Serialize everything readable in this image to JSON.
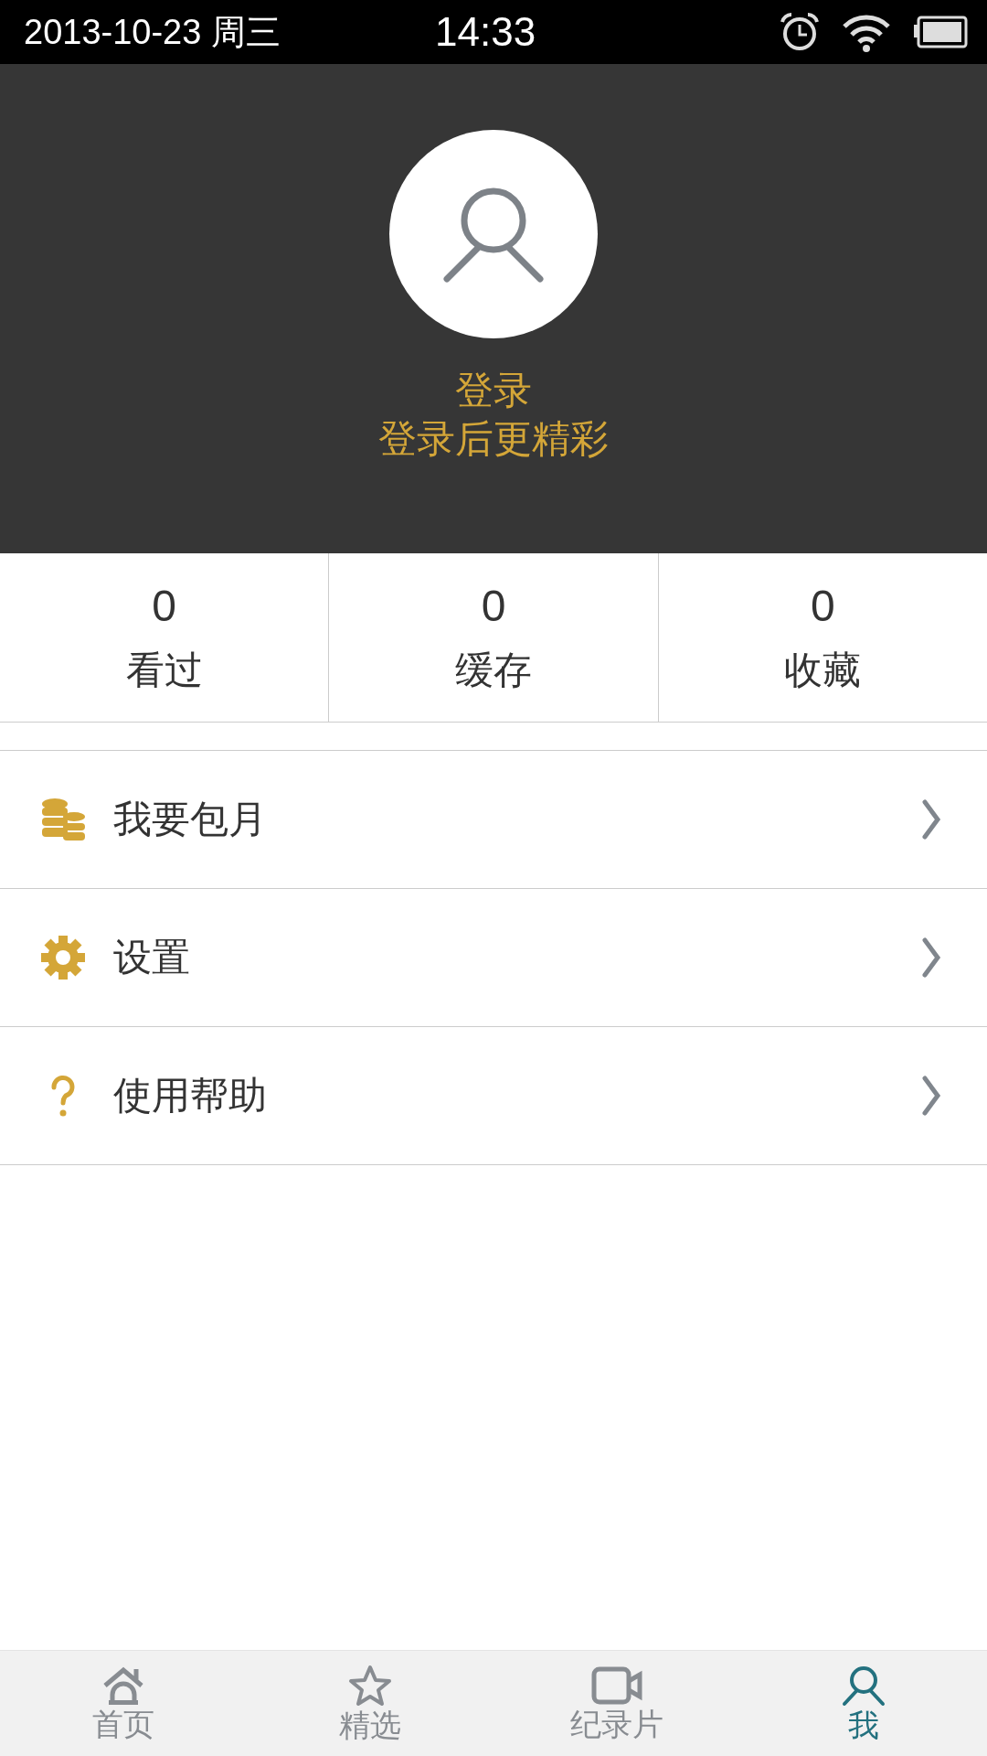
{
  "status_bar": {
    "date": "2013-10-23 周三",
    "time": "14:33"
  },
  "profile": {
    "login": "登录",
    "subtitle": "登录后更精彩"
  },
  "stats": [
    {
      "count": "0",
      "label": "看过"
    },
    {
      "count": "0",
      "label": "缓存"
    },
    {
      "count": "0",
      "label": "收藏"
    }
  ],
  "menu": [
    {
      "kind": "coins",
      "label": "我要包月"
    },
    {
      "kind": "settings",
      "label": "设置"
    },
    {
      "kind": "help",
      "label": "使用帮助"
    }
  ],
  "tabs": [
    {
      "kind": "home",
      "label": "首页",
      "selected": false
    },
    {
      "kind": "star",
      "label": "精选",
      "selected": false
    },
    {
      "kind": "video",
      "label": "纪录片",
      "selected": false
    },
    {
      "kind": "user",
      "label": "我",
      "selected": true
    }
  ]
}
